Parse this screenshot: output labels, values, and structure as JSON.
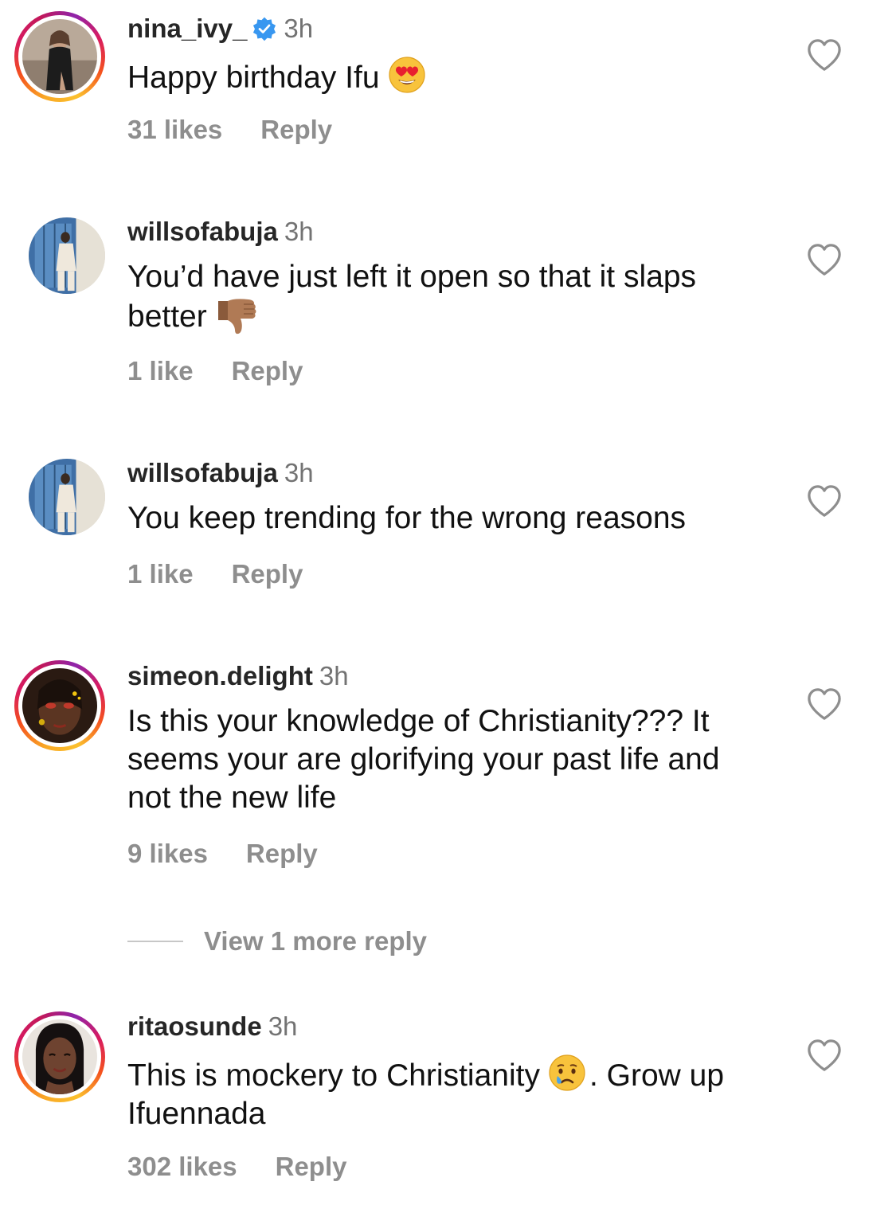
{
  "comments": [
    {
      "username": "nina_ivy_",
      "verified": true,
      "time": "3h",
      "text": "Happy birthday Ifu",
      "emoji": "heart-eyes-emoji",
      "likes": "31 likes",
      "reply": "Reply"
    },
    {
      "username": "willsofabuja",
      "time": "3h",
      "text": "You’d have just left it open so that it slaps better",
      "emoji": "thumbs-down-emoji",
      "likes": "1 like",
      "reply": "Reply"
    },
    {
      "username": "willsofabuja",
      "time": "3h",
      "text": "You keep trending for the wrong reasons",
      "likes": "1 like",
      "reply": "Reply"
    },
    {
      "username": "simeon.delight",
      "time": "3h",
      "text": "Is this your knowledge of Christianity??? It seems your are glorifying your past life and not the new life",
      "likes": "9 likes",
      "reply": "Reply"
    },
    {
      "username": "ritaosunde",
      "time": "3h",
      "text_before_emoji": "This is mockery to Christianity",
      "text_after_emoji": ". Grow up Ifuennada",
      "emoji": "crying-face-emoji",
      "likes": "302 likes",
      "reply": "Reply"
    }
  ],
  "view_more_replies": "View 1 more reply",
  "colors": {
    "secondary_text": "#8e8e8e",
    "verified_blue": "#3897f0",
    "primary_text": "#111111"
  }
}
